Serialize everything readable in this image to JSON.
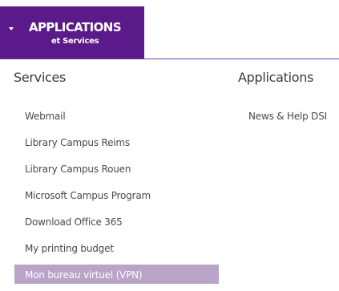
{
  "header": {
    "title": "APPLICATIONS",
    "subtitle": "et Services",
    "accent_color": "#5b1a8a",
    "caret_icon": "caret-down-icon"
  },
  "services": {
    "heading": "Services",
    "items": [
      {
        "label": "Webmail"
      },
      {
        "label": "Library Campus Reims"
      },
      {
        "label": "Library Campus Rouen"
      },
      {
        "label": "Microsoft Campus Program"
      },
      {
        "label": "Download Office 365"
      },
      {
        "label": "My printing budget"
      },
      {
        "label": "Mon bureau virtuel (VPN)",
        "active": true
      }
    ],
    "active_color": "#b9a4c8"
  },
  "applications": {
    "heading": "Applications",
    "items": [
      {
        "label": "News & Help DSI"
      }
    ]
  }
}
